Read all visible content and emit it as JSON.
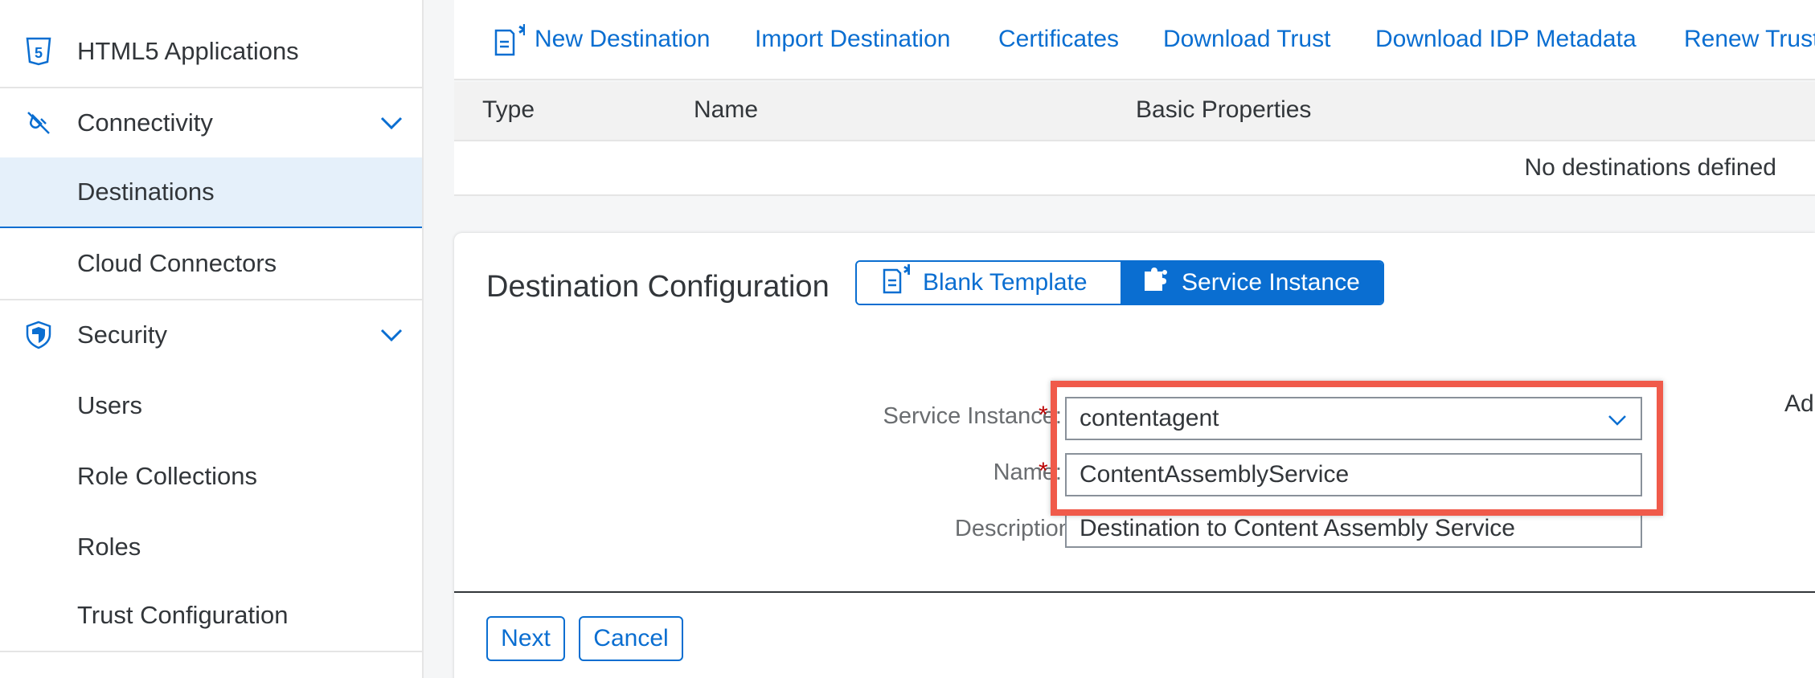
{
  "sidebar": {
    "items": [
      {
        "label": "HTML5 Applications",
        "icon": "html5-icon"
      },
      {
        "label": "Connectivity",
        "icon": "connectivity-icon",
        "expanded": true
      },
      {
        "label": "Destinations",
        "selected": true
      },
      {
        "label": "Cloud Connectors"
      },
      {
        "label": "Security",
        "icon": "shield-icon",
        "expanded": true
      },
      {
        "label": "Users"
      },
      {
        "label": "Role Collections"
      },
      {
        "label": "Roles"
      },
      {
        "label": "Trust Configuration"
      }
    ]
  },
  "toolbar": {
    "new_destination": "New Destination",
    "import_destination": "Import Destination",
    "certificates": "Certificates",
    "download_trust": "Download Trust",
    "download_idp_metadata": "Download IDP Metadata",
    "renew_trust": "Renew Trust"
  },
  "table": {
    "columns": [
      "Type",
      "Name",
      "Basic Properties"
    ],
    "empty_text": "No destinations defined"
  },
  "config": {
    "title": "Destination Configuration",
    "segments": {
      "blank": "Blank Template",
      "service": "Service Instance",
      "selected": "service"
    },
    "fields": {
      "service_instance": {
        "label": "Service Instance:",
        "value": "contentagent",
        "required": true
      },
      "name": {
        "label": "Name:",
        "value": "ContentAssemblyService",
        "required": true
      },
      "description": {
        "label": "Description:",
        "value": "Destination to Content Assembly Service"
      }
    },
    "right_partial": "Ad",
    "buttons": {
      "next": "Next",
      "cancel": "Cancel"
    }
  },
  "colors": {
    "accent": "#0a6ed1",
    "highlight": "#f05a4a",
    "required": "#bb0000",
    "selected_bg": "#e5f0fa"
  }
}
